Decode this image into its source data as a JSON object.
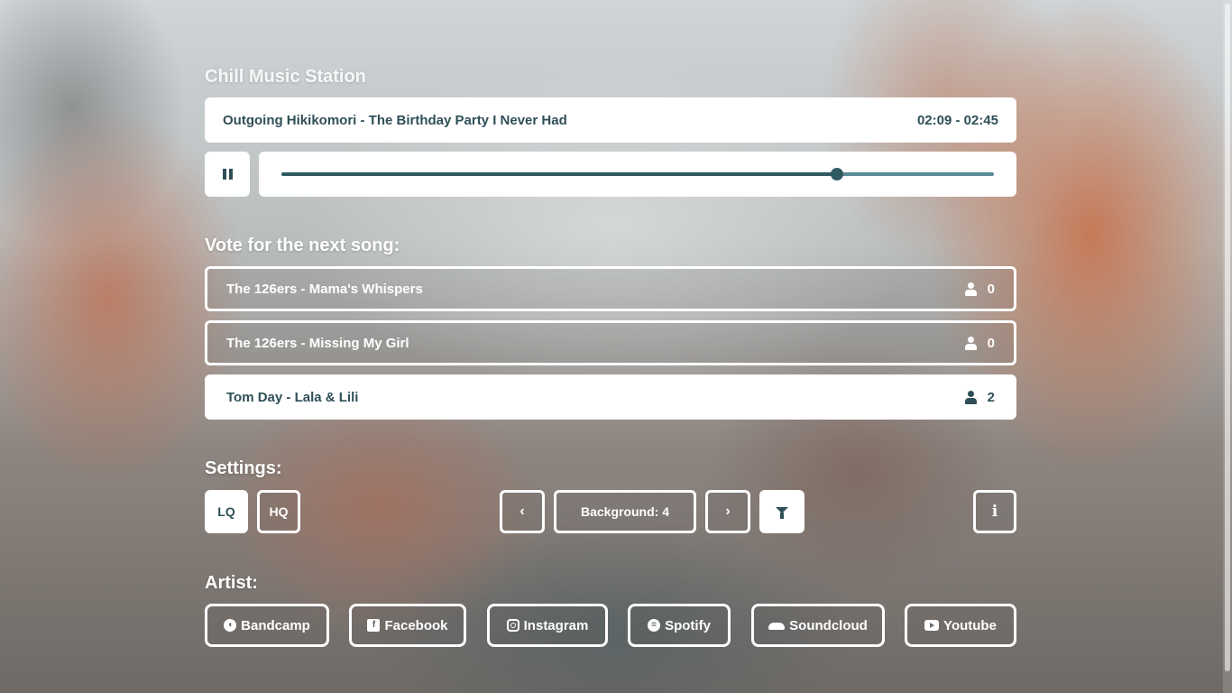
{
  "station": {
    "title": "Chill Music Station"
  },
  "player": {
    "now_playing": "Outgoing Hikikomori - The Birthday Party I Never Had",
    "time": "02:09 - 02:45",
    "progress": 0.78,
    "play_icon": "pause-icon"
  },
  "vote": {
    "heading": "Vote for the next song:",
    "items": [
      {
        "title": "The 126ers - Mama's Whispers",
        "votes": "0",
        "selected": false
      },
      {
        "title": "The 126ers - Missing My Girl",
        "votes": "0",
        "selected": false
      },
      {
        "title": "Tom Day - Lala & Lili",
        "votes": "2",
        "selected": true
      }
    ]
  },
  "settings": {
    "heading": "Settings:",
    "lq_label": "LQ",
    "hq_label": "HQ",
    "prev_icon": "chevron-left-icon",
    "background_label": "Background: 4",
    "next_icon": "chevron-right-icon",
    "filter_icon": "filter-icon",
    "info_icon": "info-icon"
  },
  "artist": {
    "heading": "Artist:",
    "links": [
      {
        "label": "Bandcamp",
        "icon": "bandcamp-icon"
      },
      {
        "label": "Facebook",
        "icon": "facebook-icon"
      },
      {
        "label": "Instagram",
        "icon": "instagram-icon"
      },
      {
        "label": "Spotify",
        "icon": "spotify-icon"
      },
      {
        "label": "Soundcloud",
        "icon": "soundcloud-icon"
      },
      {
        "label": "Youtube",
        "icon": "youtube-icon"
      }
    ]
  },
  "colors": {
    "accent": "#2f4f57",
    "track": "#5a8b96",
    "panel": "#ffffff"
  }
}
